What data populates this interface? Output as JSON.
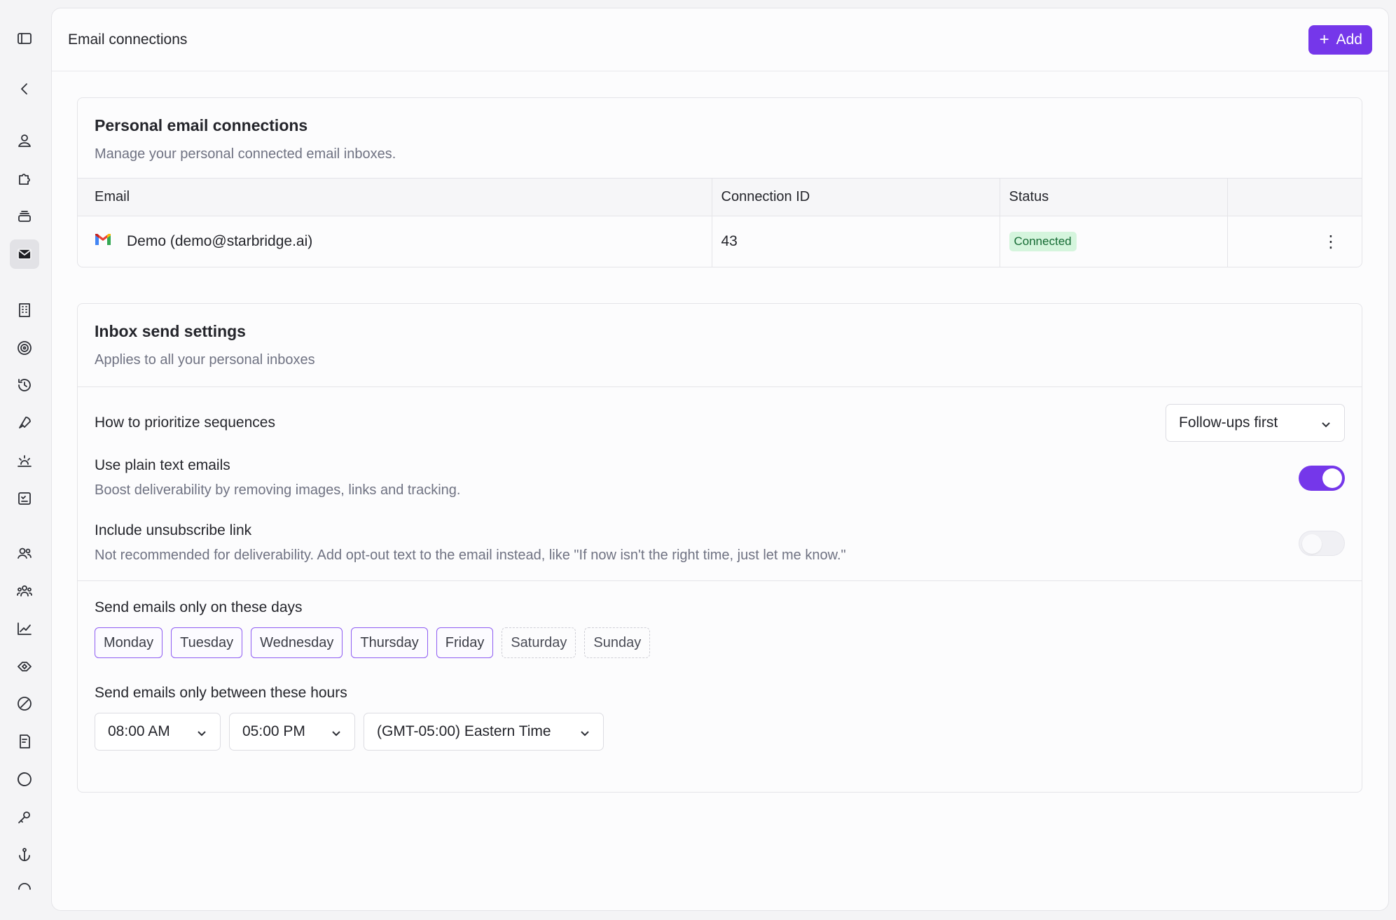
{
  "header": {
    "title": "Email connections",
    "add_label": "Add"
  },
  "sidebar": {
    "icons": [
      "panel-toggle-icon",
      "back-icon",
      "user-icon",
      "puzzle-icon",
      "layers-icon",
      "mail-icon",
      "building-icon",
      "target-icon",
      "history-icon",
      "rocket-icon",
      "sunrise-icon",
      "checklist-icon",
      "users-icon",
      "team-icon",
      "chart-icon",
      "tag-icon",
      "block-icon",
      "document-icon",
      "circle-icon",
      "key-icon",
      "anchor-icon",
      "gauge-icon"
    ],
    "active": "mail-icon"
  },
  "personal": {
    "title": "Personal email connections",
    "subtitle": "Manage your personal connected email inboxes.",
    "columns": [
      "Email",
      "Connection ID",
      "Status",
      ""
    ],
    "rows": [
      {
        "email": "Demo (demo@starbridge.ai)",
        "connection_id": "43",
        "status": "Connected"
      }
    ]
  },
  "send_settings": {
    "title": "Inbox send settings",
    "subtitle": "Applies to all your personal inboxes",
    "prioritize_label": "How to prioritize sequences",
    "prioritize_value": "Follow-ups first",
    "plain_text_label": "Use plain text emails",
    "plain_text_desc": "Boost deliverability by removing images, links and tracking.",
    "plain_text_on": true,
    "unsubscribe_label": "Include unsubscribe link",
    "unsubscribe_desc": "Not recommended for deliverability. Add opt-out text to the email instead, like \"If now isn't the right time, just let me know.\"",
    "unsubscribe_on": false,
    "days_label": "Send emails only on these days",
    "days": [
      {
        "label": "Monday",
        "selected": true
      },
      {
        "label": "Tuesday",
        "selected": true
      },
      {
        "label": "Wednesday",
        "selected": true
      },
      {
        "label": "Thursday",
        "selected": true
      },
      {
        "label": "Friday",
        "selected": true
      },
      {
        "label": "Saturday",
        "selected": false
      },
      {
        "label": "Sunday",
        "selected": false
      }
    ],
    "hours_label": "Send emails only between these hours",
    "start_time": "08:00 AM",
    "end_time": "05:00 PM",
    "timezone": "(GMT-05:00) Eastern Time"
  },
  "colors": {
    "accent": "#7537ea",
    "status_bg": "#d5f5dd",
    "status_text": "#166b34"
  }
}
